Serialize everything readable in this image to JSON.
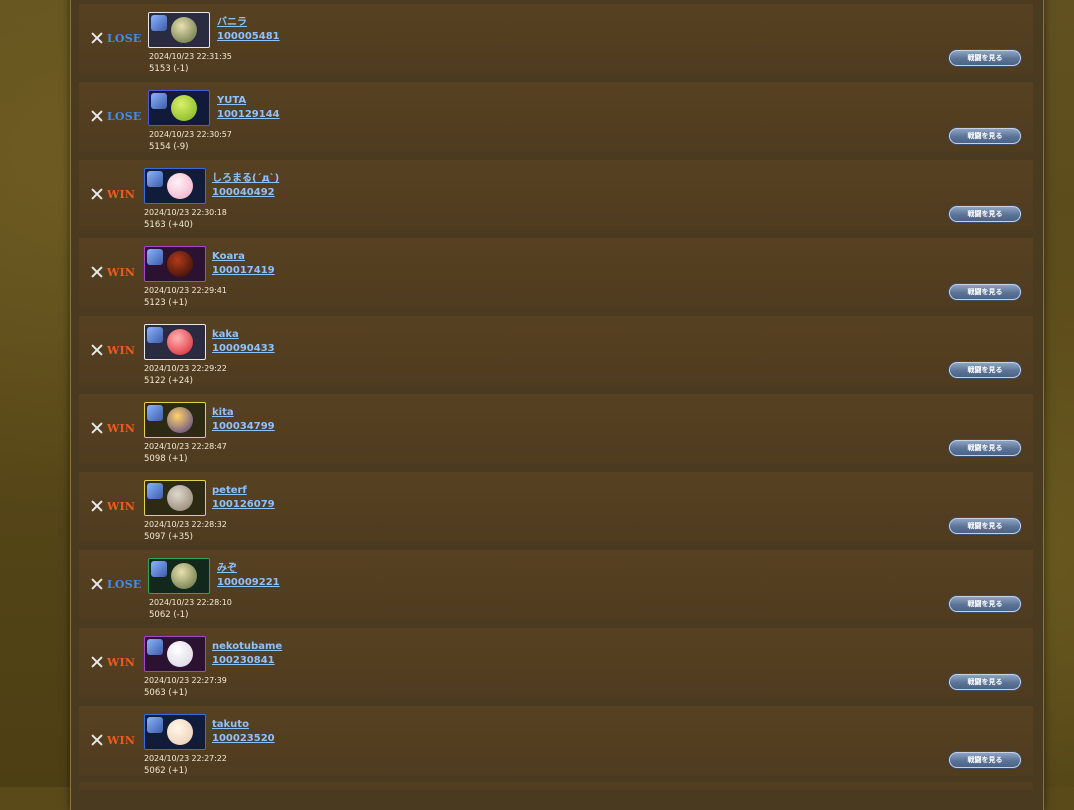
{
  "battles": [
    {
      "result": "LOSE",
      "name": "バニラ",
      "id": "100005481",
      "time": "2024/10/23 22:31:35",
      "rating": "5153 (-1)",
      "button": "戦闘を見る",
      "avatar_icon": "player-avatar-icon"
    },
    {
      "result": "LOSE",
      "name": "YUTA",
      "id": "100129144",
      "time": "2024/10/23 22:30:57",
      "rating": "5154 (-9)",
      "button": "戦闘を見る",
      "avatar_icon": "player-avatar-icon"
    },
    {
      "result": "WIN",
      "name": "しろまる(´д`)",
      "id": "100040492",
      "time": "2024/10/23 22:30:18",
      "rating": "5163 (+40)",
      "button": "戦闘を見る",
      "avatar_icon": "player-avatar-icon"
    },
    {
      "result": "WIN",
      "name": "Koara",
      "id": "100017419",
      "time": "2024/10/23 22:29:41",
      "rating": "5123 (+1)",
      "button": "戦闘を見る",
      "avatar_icon": "player-avatar-icon"
    },
    {
      "result": "WIN",
      "name": "kaka",
      "id": "100090433",
      "time": "2024/10/23 22:29:22",
      "rating": "5122 (+24)",
      "button": "戦闘を見る",
      "avatar_icon": "player-avatar-icon"
    },
    {
      "result": "WIN",
      "name": "kita",
      "id": "100034799",
      "time": "2024/10/23 22:28:47",
      "rating": "5098 (+1)",
      "button": "戦闘を見る",
      "avatar_icon": "player-avatar-icon"
    },
    {
      "result": "WIN",
      "name": "peterf",
      "id": "100126079",
      "time": "2024/10/23 22:28:32",
      "rating": "5097 (+35)",
      "button": "戦闘を見る",
      "avatar_icon": "player-avatar-icon"
    },
    {
      "result": "LOSE",
      "name": "みぞ",
      "id": "100009221",
      "time": "2024/10/23 22:28:10",
      "rating": "5062 (-1)",
      "button": "戦闘を見る",
      "avatar_icon": "player-avatar-icon"
    },
    {
      "result": "WIN",
      "name": "nekotubame",
      "id": "100230841",
      "time": "2024/10/23 22:27:39",
      "rating": "5063 (+1)",
      "button": "戦闘を見る",
      "avatar_icon": "player-avatar-icon"
    },
    {
      "result": "WIN",
      "name": "takuto",
      "id": "100023520",
      "time": "2024/10/23 22:27:22",
      "rating": "5062 (+1)",
      "button": "戦闘を見る",
      "avatar_icon": "player-avatar-icon"
    }
  ],
  "colors": {
    "win": "#f05a1a",
    "lose": "#3f8ef0",
    "link": "#8ec2ff",
    "row_bg": "#523d21",
    "button": "#5b7396"
  },
  "icons": {
    "result": "crossed-swords-icon"
  }
}
